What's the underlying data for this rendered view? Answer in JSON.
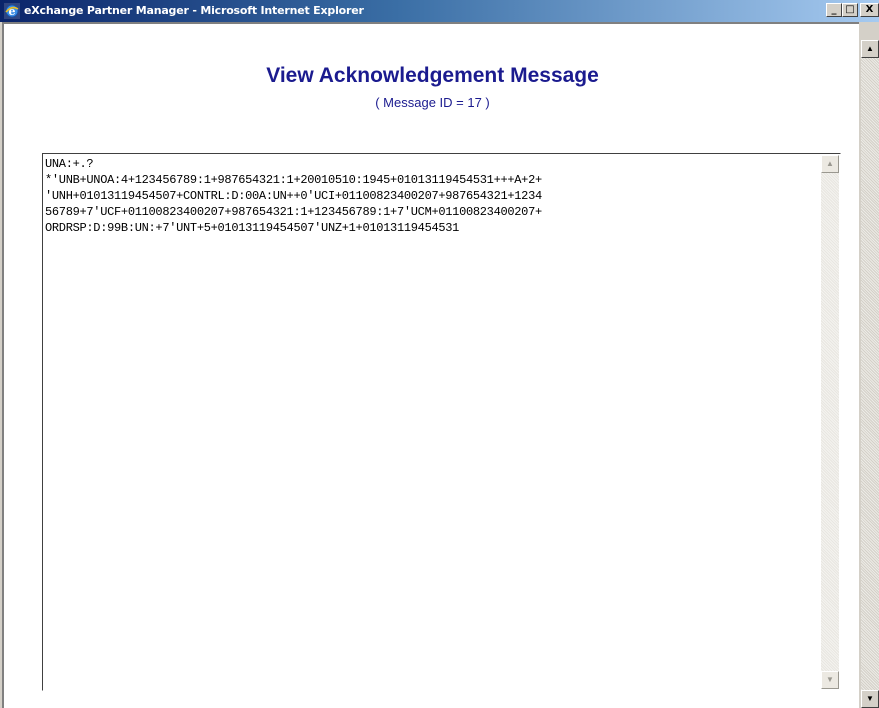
{
  "window": {
    "title": "eXchange Partner Manager - Microsoft Internet Explorer",
    "minimize_glyph": "_",
    "maximize_glyph": "□",
    "close_glyph": "X",
    "icon": "internet-explorer-icon"
  },
  "page": {
    "title": "View Acknowledgement Message",
    "subtitle": "( Message ID = 17 )"
  },
  "message_box": {
    "lines": [
      "UNA:+.?",
      "*'UNB+UNOA:4+123456789:1+987654321:1+20010510:1945+01013119454531+++A+2+",
      "'UNH+01013119454507+CONTRL:D:00A:UN++0'UCI+01100823400207+987654321+1234",
      "56789+7'UCF+01100823400207+987654321:1+123456789:1+7'UCM+01100823400207+",
      "ORDRSP:D:99B:UN:+7'UNT+5+01013119454507'UNZ+1+01013119454531"
    ]
  },
  "colors": {
    "title_color": "#1b1b8f",
    "titlebar_start": "#0a246a",
    "titlebar_end": "#a6caf0"
  }
}
